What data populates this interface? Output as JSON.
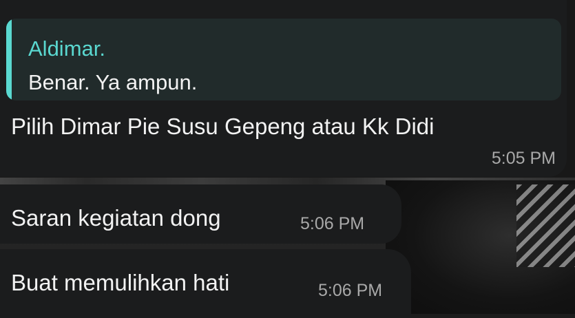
{
  "messages": [
    {
      "reply_to": {
        "author": "Aldimar.",
        "text": "Benar. Ya ampun."
      },
      "text": "Pilih Dimar Pie Susu Gepeng atau Kk Didi",
      "time": "5:05 PM"
    },
    {
      "text": "Saran kegiatan dong",
      "time": "5:06 PM"
    },
    {
      "text": "Buat memulihkan hati",
      "time": "5:06 PM"
    }
  ],
  "colors": {
    "bubble": "#1b1c1d",
    "quote_background": "#212b2b",
    "quote_accent": "#5ad8d0",
    "text": "#f2f2f2",
    "timestamp": "#a9a9a9"
  }
}
